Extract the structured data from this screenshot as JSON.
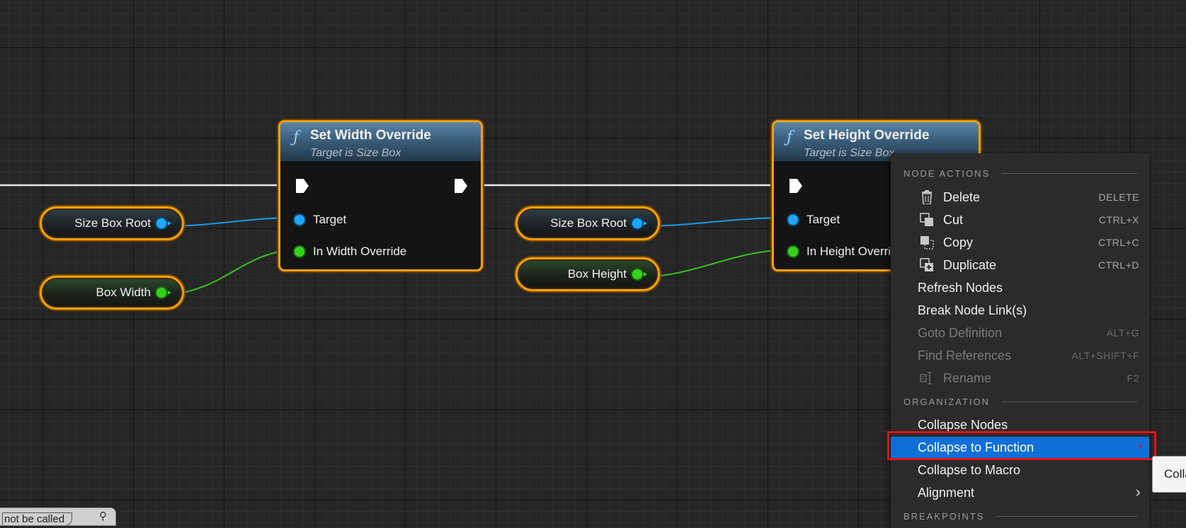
{
  "var_nodes": [
    {
      "label": "Size Box Root",
      "type": "object"
    },
    {
      "label": "Box Width",
      "type": "float"
    },
    {
      "label": "Size Box Root",
      "type": "object"
    },
    {
      "label": "Box Height",
      "type": "float"
    }
  ],
  "func_nodes": [
    {
      "title": "Set Width Override",
      "subtitle": "Target is Size Box",
      "pin_target": "Target",
      "pin_value": "In Width Override"
    },
    {
      "title": "Set Height Override",
      "subtitle": "Target is Size Box",
      "pin_target": "Target",
      "pin_value": "In Height Override"
    }
  ],
  "context_menu": {
    "sections": [
      {
        "header": "NODE ACTIONS"
      },
      {
        "header": "ORGANIZATION"
      },
      {
        "header": "BREAKPOINTS"
      }
    ],
    "items": [
      {
        "label": "Delete",
        "shortcut": "DELETE",
        "icon": "trash-icon",
        "enabled": true
      },
      {
        "label": "Cut",
        "shortcut": "CTRL+X",
        "icon": "cut-icon",
        "enabled": true
      },
      {
        "label": "Copy",
        "shortcut": "CTRL+C",
        "icon": "copy-icon",
        "enabled": true
      },
      {
        "label": "Duplicate",
        "shortcut": "CTRL+D",
        "icon": "duplicate-icon",
        "enabled": true
      },
      {
        "label": "Refresh Nodes",
        "shortcut": "",
        "enabled": true
      },
      {
        "label": "Break Node Link(s)",
        "shortcut": "",
        "enabled": true
      },
      {
        "label": "Goto Definition",
        "shortcut": "ALT+G",
        "enabled": false
      },
      {
        "label": "Find References",
        "shortcut": "ALT+SHIFT+F",
        "enabled": false
      },
      {
        "label": "Rename",
        "shortcut": "F2",
        "icon": "rename-icon",
        "enabled": false
      },
      {
        "label": "Collapse Nodes",
        "shortcut": "",
        "enabled": true
      },
      {
        "label": "Collapse to Function",
        "shortcut": "",
        "enabled": true,
        "highlighted": true
      },
      {
        "label": "Collapse to Macro",
        "shortcut": "",
        "enabled": true
      },
      {
        "label": "Alignment",
        "shortcut": "",
        "enabled": true,
        "submenu": true
      }
    ]
  },
  "tooltip": {
    "text": "Colla"
  },
  "comment": {
    "text": "not be called"
  },
  "colors": {
    "accent_selection": "#f6a10a",
    "object_pin": "#1ea8ff",
    "float_pin": "#36d11e",
    "highlight": "#0e70d6",
    "annotation_box": "#e8101a"
  }
}
